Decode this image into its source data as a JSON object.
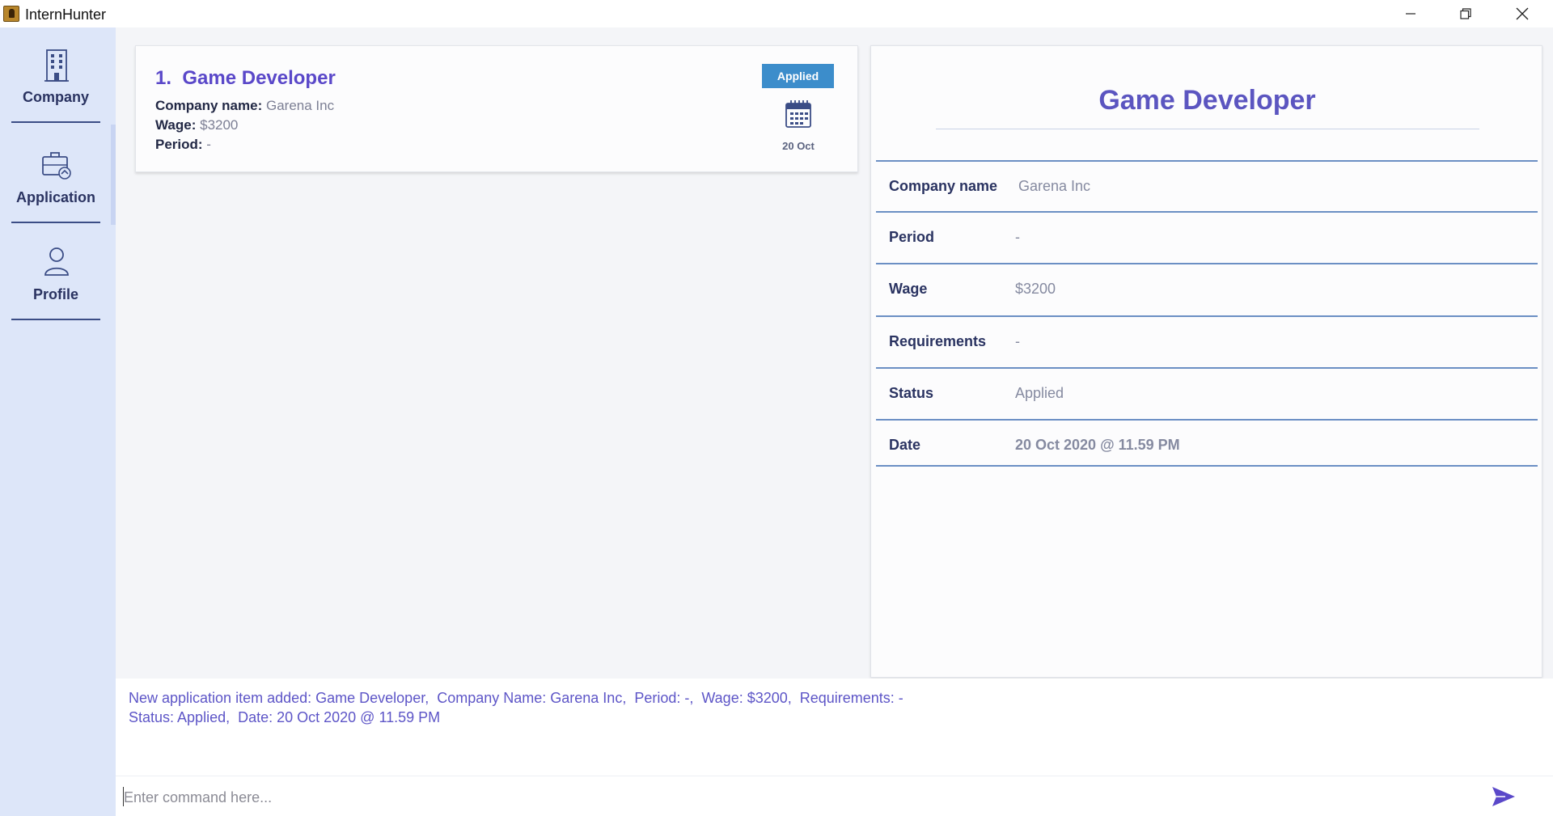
{
  "window": {
    "title": "InternHunter",
    "icons": {
      "minimize": "minimize-icon",
      "maximize": "restore-icon",
      "close": "close-icon"
    }
  },
  "sidebar": {
    "items": [
      {
        "label": "Company",
        "icon": "building-icon"
      },
      {
        "label": "Application",
        "icon": "briefcase-icon"
      },
      {
        "label": "Profile",
        "icon": "person-icon"
      }
    ]
  },
  "list": {
    "items": [
      {
        "index": "1.",
        "title": "Game Developer",
        "company_label": "Company name:",
        "company_value": "Garena Inc",
        "wage_label": "Wage:",
        "wage_value": "$3200",
        "period_label": "Period:",
        "period_value": "-",
        "status": "Applied",
        "date": "20 Oct"
      }
    ]
  },
  "detail": {
    "title": "Game Developer",
    "rows": [
      {
        "key": "Company name",
        "value": "Garena Inc"
      },
      {
        "key": "Period",
        "value": "-"
      },
      {
        "key": "Wage",
        "value": "$3200"
      },
      {
        "key": "Requirements",
        "value": "-"
      },
      {
        "key": "Status",
        "value": "Applied"
      },
      {
        "key": "Date",
        "value": "20 Oct 2020 @ 11.59 PM"
      }
    ]
  },
  "result": {
    "line1": "New application item added: Game Developer,  Company Name: Garena Inc,  Period: -,  Wage: $3200,  Requirements: -",
    "line2": "Status: Applied,  Date: 20 Oct 2020 @ 11.59 PM"
  },
  "command": {
    "placeholder": "Enter command here...",
    "value": ""
  },
  "colors": {
    "accent": "#5a48c9",
    "badge": "#3c8dcb",
    "sidebar": "#dde6f9",
    "divider": "#6b8fc4"
  }
}
